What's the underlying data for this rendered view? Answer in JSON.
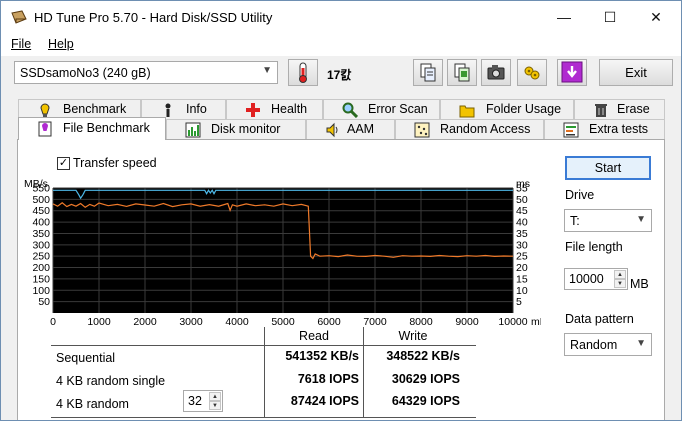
{
  "window": {
    "title": "HD Tune Pro 5.70 - Hard Disk/SSD Utility",
    "controls": {
      "minimize": "—",
      "maximize": "☐",
      "close": "✕"
    }
  },
  "menu": {
    "file": "File",
    "help": "Help"
  },
  "toolbar": {
    "drive": "SSDsamoNo3 (240 gB)",
    "temperature": "17캀",
    "exit": "Exit",
    "icons": [
      "copy-info-icon",
      "copy-screen-icon",
      "camera-icon",
      "settings-icon",
      "download-icon"
    ]
  },
  "tabs": {
    "row1": [
      "Benchmark",
      "Info",
      "Health",
      "Error Scan",
      "Folder Usage",
      "Erase"
    ],
    "row2": [
      "File Benchmark",
      "Disk monitor",
      "AAM",
      "Random Access",
      "Extra tests"
    ],
    "active": "File Benchmark"
  },
  "benchmark": {
    "transfer_speed_label": "Transfer speed",
    "transfer_speed_checked": true,
    "start": "Start",
    "drive_label": "Drive",
    "drive_value": "T:",
    "file_length_label": "File length",
    "file_length_value": "10000",
    "file_length_unit": "MB",
    "data_pattern_label": "Data pattern",
    "data_pattern_value": "Random"
  },
  "results": {
    "col_read": "Read",
    "col_write": "Write",
    "rows": [
      {
        "label": "Sequential",
        "read": "541352 KB/s",
        "write": "348522 KB/s"
      },
      {
        "label": "4 KB random single",
        "read": "7618 IOPS",
        "write": "30629 IOPS"
      },
      {
        "label": "4 KB random",
        "read": "87424 IOPS",
        "write": "64329 IOPS"
      }
    ],
    "queue_depth": "32"
  },
  "chart_data": {
    "type": "line",
    "ylabel_left": "MB/s",
    "ylabel_right": "ms",
    "xunit": "mB",
    "x_ticks": [
      "0",
      "1000",
      "2000",
      "3000",
      "4000",
      "5000",
      "6000",
      "7000",
      "8000",
      "9000",
      "10000"
    ],
    "y_ticks_left": [
      "550",
      "500",
      "450",
      "400",
      "350",
      "300",
      "250",
      "200",
      "150",
      "100",
      "50"
    ],
    "y_ticks_right": [
      "55",
      "50",
      "45",
      "40",
      "35",
      "30",
      "25",
      "20",
      "15",
      "10",
      "5"
    ],
    "xlim": [
      0,
      10000
    ],
    "ylim": [
      0,
      550
    ],
    "grid": true,
    "background": "#000000",
    "series": [
      {
        "color": "#4db8e8",
        "x": [
          0,
          500,
          560,
          600,
          650,
          700,
          3300,
          3340,
          3380,
          3420,
          3460,
          3500,
          3540,
          10000
        ],
        "y": [
          540,
          540,
          520,
          505,
          520,
          540,
          540,
          525,
          540,
          528,
          540,
          525,
          540,
          540
        ]
      },
      {
        "color": "#f07a2a",
        "x": [
          0,
          100,
          200,
          300,
          400,
          500,
          600,
          700,
          800,
          900,
          1000,
          1200,
          1400,
          1600,
          1800,
          2000,
          2200,
          2400,
          2600,
          2800,
          3000,
          3200,
          3400,
          3600,
          3800,
          3850,
          3900,
          4000,
          4200,
          4400,
          4600,
          4800,
          5000,
          5200,
          5400,
          5550,
          5600,
          5650,
          5700,
          5800,
          6000,
          6200,
          6400,
          6600,
          6800,
          7000,
          7200,
          7400,
          7600,
          7800,
          8000,
          8200,
          8400,
          8600,
          8800,
          9000,
          9200,
          9400,
          9600,
          9800,
          10000
        ],
        "y": [
          480,
          470,
          485,
          468,
          478,
          470,
          482,
          465,
          478,
          470,
          484,
          472,
          478,
          469,
          480,
          475,
          470,
          482,
          468,
          476,
          480,
          470,
          477,
          470,
          482,
          452,
          476,
          470,
          480,
          472,
          476,
          470,
          480,
          472,
          478,
          470,
          250,
          240,
          260,
          250,
          252,
          248,
          255,
          250,
          249,
          253,
          250,
          245,
          252,
          250,
          251,
          249,
          253,
          250,
          248,
          252,
          250,
          253,
          249,
          251,
          250
        ]
      }
    ]
  }
}
